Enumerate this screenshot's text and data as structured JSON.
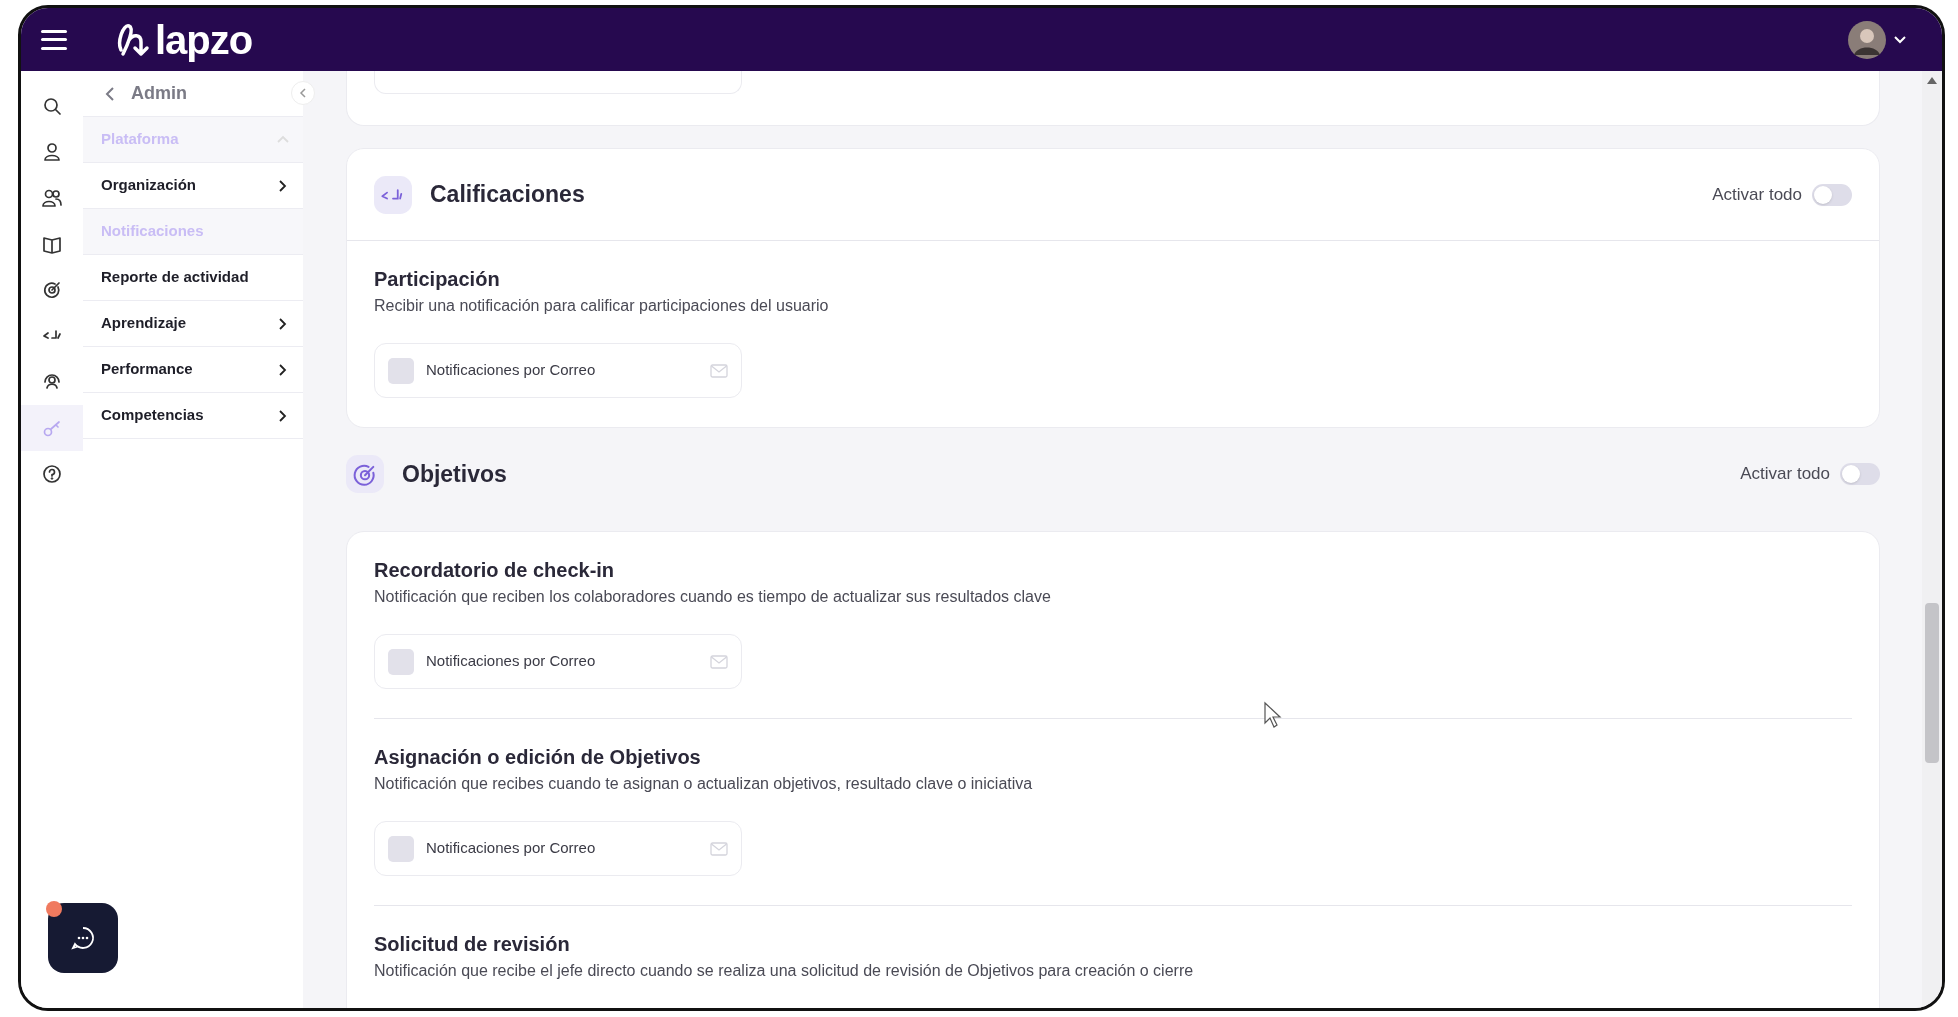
{
  "header": {
    "logo": "lapzo"
  },
  "rail": [
    {
      "selected": false
    },
    {
      "selected": false
    },
    {
      "selected": false
    },
    {
      "selected": false
    },
    {
      "selected": false
    },
    {
      "selected": false
    },
    {
      "selected": false
    },
    {
      "selected": true
    },
    {
      "selected": false
    }
  ],
  "sidebar": {
    "back_label": "Admin",
    "items": [
      {
        "label": "Plataforma",
        "kind": "group",
        "expanded": true,
        "selected": true
      },
      {
        "label": "Organización",
        "kind": "submenu",
        "selected": false
      },
      {
        "label": "Notificaciones",
        "kind": "link",
        "selected": true
      },
      {
        "label": "Reporte de actividad",
        "kind": "link",
        "selected": false
      },
      {
        "label": "Aprendizaje",
        "kind": "submenu",
        "selected": false
      },
      {
        "label": "Performance",
        "kind": "submenu",
        "selected": false
      },
      {
        "label": "Competencias",
        "kind": "submenu",
        "selected": false
      }
    ]
  },
  "sections": [
    {
      "kind": "card-header",
      "title": "Calificaciones",
      "toggle_label": "Activar todo",
      "on": false,
      "items": [
        {
          "title": "Participación",
          "description": "Recibir una notificación para calificar participaciones del usuario",
          "channel": {
            "label": "Notificaciones por Correo",
            "checked": false
          }
        }
      ]
    },
    {
      "kind": "plain-header",
      "title": "Objetivos",
      "toggle_label": "Activar todo",
      "on": false,
      "items": [
        {
          "title": "Recordatorio de check-in",
          "description": "Notificación que reciben los colaboradores cuando es tiempo de actualizar sus resultados clave",
          "channel": {
            "label": "Notificaciones por Correo",
            "checked": false
          }
        },
        {
          "title": "Asignación o edición de Objetivos",
          "description": "Notificación que recibes cuando te asignan o actualizan objetivos, resultado clave o iniciativa",
          "channel": {
            "label": "Notificaciones por Correo",
            "checked": false
          }
        },
        {
          "title": "Solicitud de revisión",
          "description": "Notificación que recibe el jefe directo cuando se realiza una solicitud de revisión de Objetivos para creación o cierre"
        }
      ]
    }
  ],
  "chat": {
    "unread": true
  }
}
